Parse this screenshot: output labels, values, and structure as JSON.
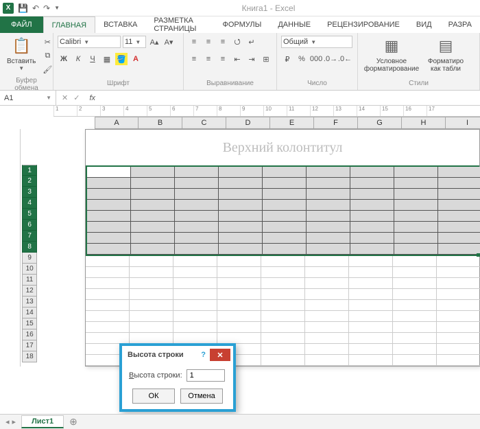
{
  "app": {
    "title": "Книга1 - Excel"
  },
  "qat": {
    "save_tip": "Сохранить",
    "undo_tip": "Отменить",
    "redo_tip": "Вернуть"
  },
  "tabs": {
    "file": "ФАЙЛ",
    "items": [
      "ГЛАВНАЯ",
      "ВСТАВКА",
      "РАЗМЕТКА СТРАНИЦЫ",
      "ФОРМУЛЫ",
      "ДАННЫЕ",
      "РЕЦЕНЗИРОВАНИЕ",
      "ВИД",
      "РАЗРА"
    ]
  },
  "ribbon": {
    "clipboard": {
      "paste": "Вставить",
      "title": "Буфер обмена"
    },
    "font": {
      "name": "Calibri",
      "size": "11",
      "title": "Шрифт",
      "bold": "Ж",
      "italic": "К",
      "underline": "Ч"
    },
    "alignment": {
      "title": "Выравнивание"
    },
    "number": {
      "format": "Общий",
      "title": "Число"
    },
    "styles": {
      "cond_format": "Условное форматирование",
      "format_table": "Форматиро как табли",
      "title": "Стили"
    }
  },
  "formula_bar": {
    "cell_ref": "A1",
    "fx_label": "fx",
    "value": ""
  },
  "columns": [
    "A",
    "B",
    "C",
    "D",
    "E",
    "F",
    "G",
    "H",
    "I"
  ],
  "selected_rows": [
    1,
    2,
    3,
    4,
    5,
    6,
    7,
    8
  ],
  "unselected_rows": [
    9,
    10,
    11,
    12,
    13,
    14,
    15,
    16,
    17,
    18
  ],
  "header_text": "Верхний колонтитул",
  "dialog": {
    "title": "Высота строки",
    "label": "Высота строки:",
    "label_accel": "В",
    "value": "1",
    "ok": "ОК",
    "cancel": "Отмена"
  },
  "sheet_tabs": {
    "active": "Лист1"
  }
}
